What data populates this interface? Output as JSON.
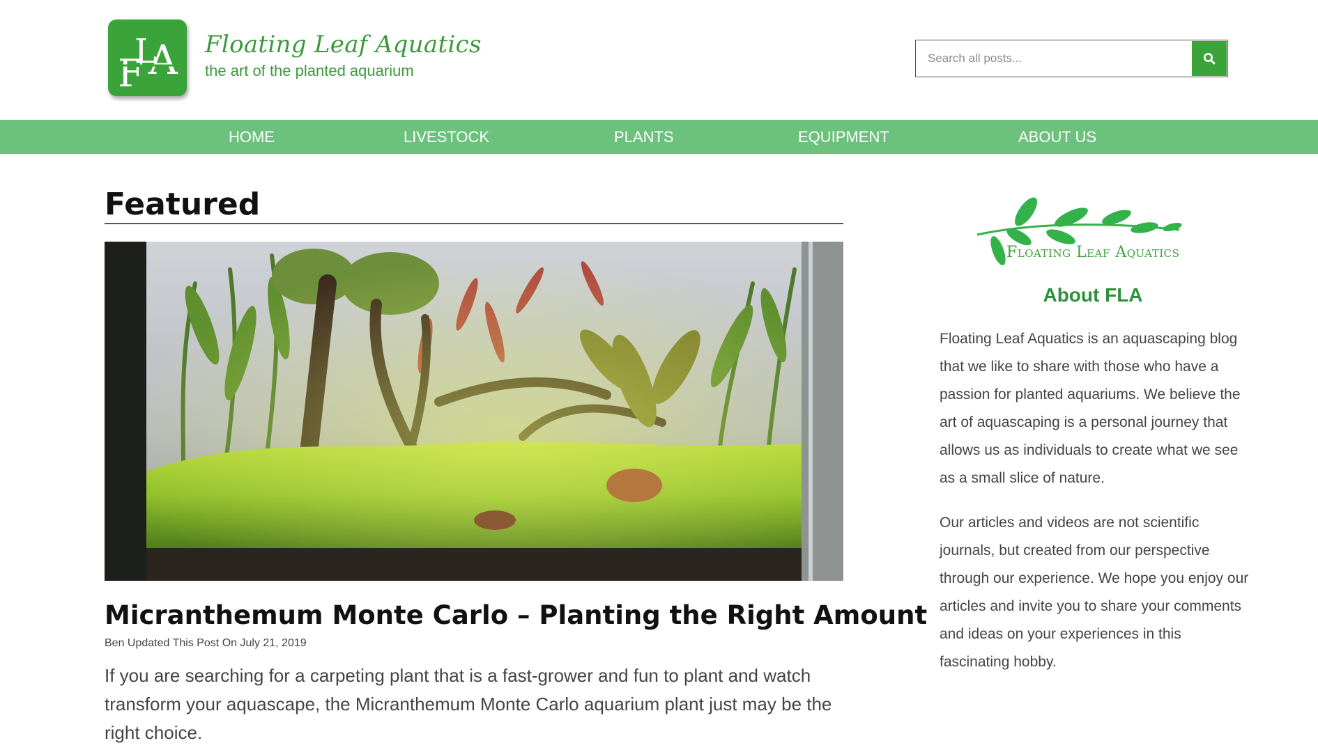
{
  "header": {
    "logo_letters": "FLA",
    "site_title": "Floating Leaf Aquatics",
    "tagline": "the art of the planted aquarium",
    "search_placeholder": "Search all posts...",
    "search_icon": "search-icon",
    "brand_color": "#3aa33a"
  },
  "nav": {
    "items": [
      {
        "label": "HOME"
      },
      {
        "label": "LIVESTOCK"
      },
      {
        "label": "PLANTS"
      },
      {
        "label": "EQUIPMENT"
      },
      {
        "label": "ABOUT US"
      }
    ],
    "background": "#6cc27d"
  },
  "main": {
    "section_heading": "Featured",
    "post": {
      "title": "Micranthemum Monte Carlo – Planting the Right Amount",
      "meta": "Ben Updated This Post On July 21, 2019",
      "excerpt": "If you are searching for a carpeting plant that is a fast-grower and fun to plant and watch transform your aquascape, the Micranthemum Monte Carlo aquarium plant just may be the right choice."
    }
  },
  "sidebar": {
    "logo_text": "Floating Leaf Aquatics",
    "about_heading": "About FLA",
    "about_p1": "Floating Leaf Aquatics is an aquascaping blog that we like to share with those who have a passion for planted aquariums. We believe the art of aquascaping is a personal journey that allows us as individuals to create what we see as a small slice of nature.",
    "about_p2": "Our articles and videos are not scientific journals, but created from our perspective through our experience. We hope you enjoy our articles and invite you to share your comments and ideas on your experiences in this fascinating hobby."
  }
}
